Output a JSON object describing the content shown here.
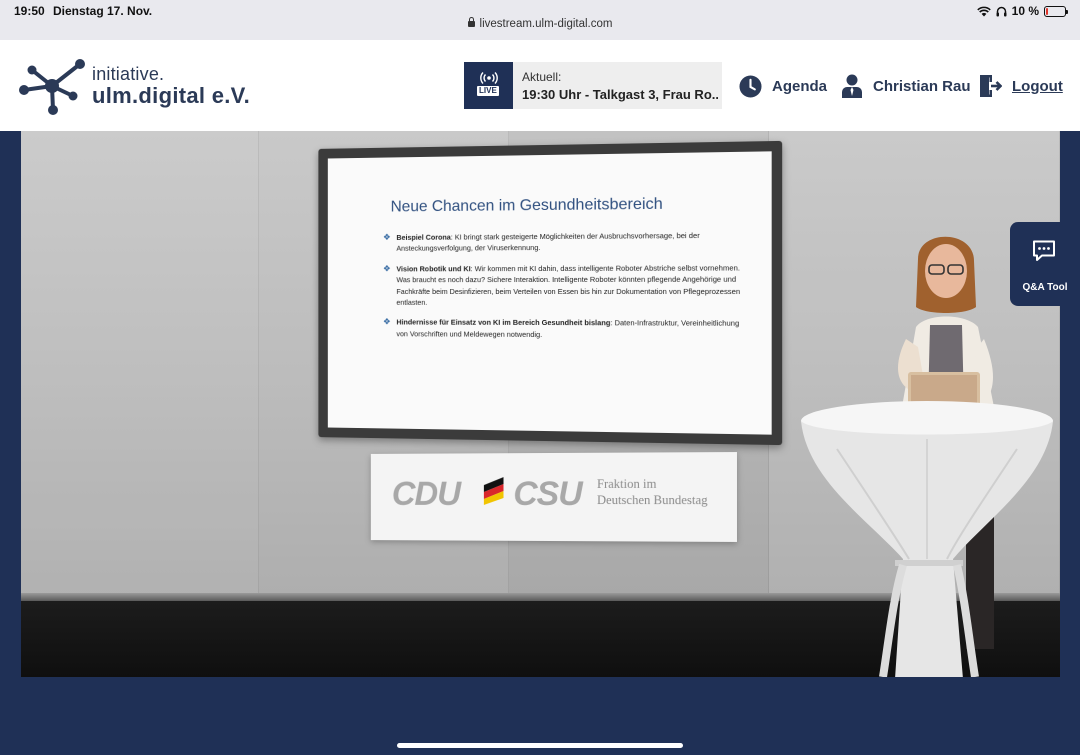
{
  "status_bar": {
    "time": "19:50",
    "date": "Dienstag 17. Nov.",
    "url": "livestream.ulm-digital.com",
    "battery": "10 %",
    "battery_level": 0.1,
    "icons": [
      "wifi-icon",
      "headphones-icon",
      "battery-icon",
      "lock-icon"
    ]
  },
  "header": {
    "logo_line1": "initiative.",
    "logo_line2": "ulm.digital e.V.",
    "live": {
      "badge": "LIVE",
      "caption": "Aktuell:",
      "title": "19:30 Uhr - Talkgast 3, Frau Ro..."
    },
    "nav": {
      "agenda": "Agenda",
      "user": "Christian Rau",
      "logout": "Logout"
    }
  },
  "video": {
    "slide": {
      "title": "Neue Chancen im Gesundheitsbereich",
      "bullets": [
        {
          "bold": "Beispiel Corona",
          "text": ": KI bringt stark gesteigerte Möglichkeiten der Ausbruchsvorhersage, bei der Ansteckungsverfolgung, der Viruserkennung."
        },
        {
          "bold": "Vision Robotik und KI",
          "text": ": Wir kommen mit KI dahin, dass intelligente Roboter Abstriche selbst vornehmen. Was braucht es noch dazu? Sichere Interaktion. Intelligente Roboter könnten pflegende Angehörige und Fachkräfte beim Desinfizieren, beim Verteilen von Essen bis hin zur Dokumentation von Pflegeprozessen entlasten."
        },
        {
          "bold": "Hindernisse für Einsatz von KI im Bereich Gesundheit bislang",
          "text": ": Daten-Infrastruktur, Vereinheitlichung von Vorschriften und Meldewegen notwendig."
        }
      ]
    },
    "sign": {
      "cdu": "CDU",
      "csu": "CSU",
      "fraktion_line1": "Fraktion im",
      "fraktion_line2": "Deutschen Bundestag"
    }
  },
  "qa_tool": {
    "label": "Q&A Tool"
  },
  "colors": {
    "navy": "#1f3056",
    "logo_text": "#2b3a57",
    "slide_title": "#2f4f7f",
    "battery_low": "#e0352b"
  }
}
